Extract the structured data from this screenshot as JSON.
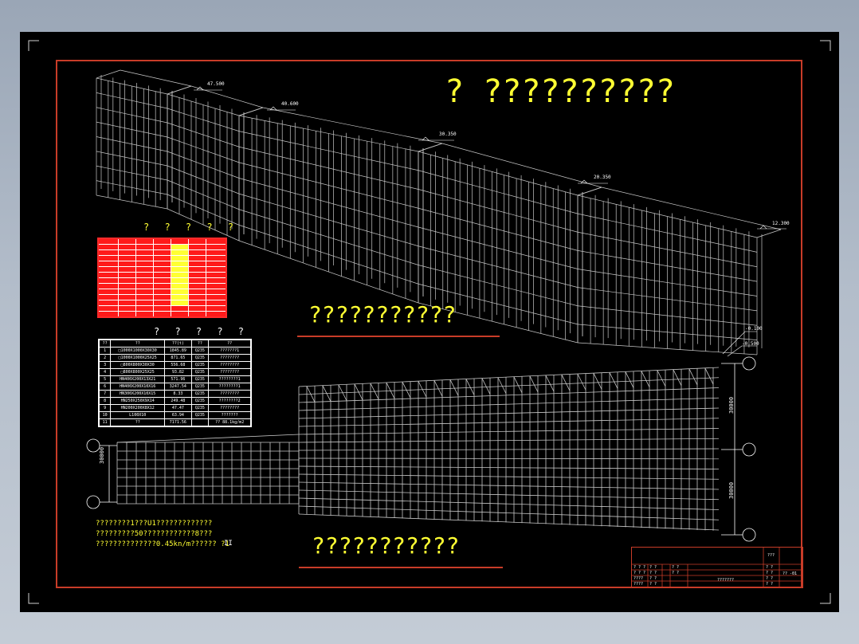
{
  "drawing": {
    "main_title": "?  ??????????",
    "view_3d_caption": "???????????",
    "elevation_caption": "???????????",
    "elevations": [
      "47.500",
      "40.600",
      "30.350",
      "20.350",
      "12.300"
    ],
    "ground_levels": [
      "-0.100",
      "-0.500"
    ],
    "dims": {
      "left_span": "30000",
      "right_top": "30000",
      "right_bottom": "30000"
    },
    "notes": [
      "????????1???U1?????????????",
      "?????????50????????????8???",
      "??????????????0.45kn/m?????? ?1"
    ],
    "notes_suffix": "II",
    "steel_table_title": "? ? ? ? ?",
    "material_table_title": "? ? ? ? ?"
  },
  "material_table": {
    "headers": [
      "??",
      "??",
      "??(t)",
      "??",
      "??"
    ],
    "rows": [
      [
        "1",
        "□1000X1000X30X30",
        "1845.89",
        "Q235",
        "???????1"
      ],
      [
        "2",
        "□1000X1000X25X25",
        "871.65",
        "Q235",
        "????????"
      ],
      [
        "3",
        "□800X800X30X30",
        "556.68",
        "Q235",
        "????????"
      ],
      [
        "4",
        "□800X800X25X25",
        "93.82",
        "Q235",
        "????????"
      ],
      [
        "5",
        "HN400X200X13X21",
        "571.96",
        "Q235",
        "????????1"
      ],
      [
        "6",
        "HN400X200X10X16",
        "3247.54",
        "Q235",
        "????????1"
      ],
      [
        "7",
        "HN300X200X10X15",
        "8.33",
        "Q235",
        "????????"
      ],
      [
        "8",
        "HN250X250X9X14",
        "249.48",
        "Q235",
        "????????2"
      ],
      [
        "9",
        "HN200X200X8X12",
        "47.47",
        "Q235",
        "????????"
      ],
      [
        "10",
        "L100X10",
        "63.94",
        "Q235",
        "???????"
      ],
      [
        "11",
        "??",
        "7171.56",
        "",
        "?? 88.1kg/m2"
      ]
    ]
  },
  "title_block": {
    "header": "???",
    "drawing_name": "???????",
    "rows": [
      [
        "? ? ?",
        "? ?",
        "? ?",
        "? ?"
      ],
      [
        "? ? ?",
        "? ?",
        "? ?",
        "? ?"
      ],
      [
        "????",
        "? ?",
        "",
        "? ?"
      ],
      [
        "????",
        "? ?",
        "",
        "? ?"
      ]
    ],
    "sheet_no": "?? -01"
  },
  "colors": {
    "frame": "#c83c28",
    "text": "#ffff33",
    "structure": "#c8c8c8",
    "table_red": "#ff1a1a"
  }
}
